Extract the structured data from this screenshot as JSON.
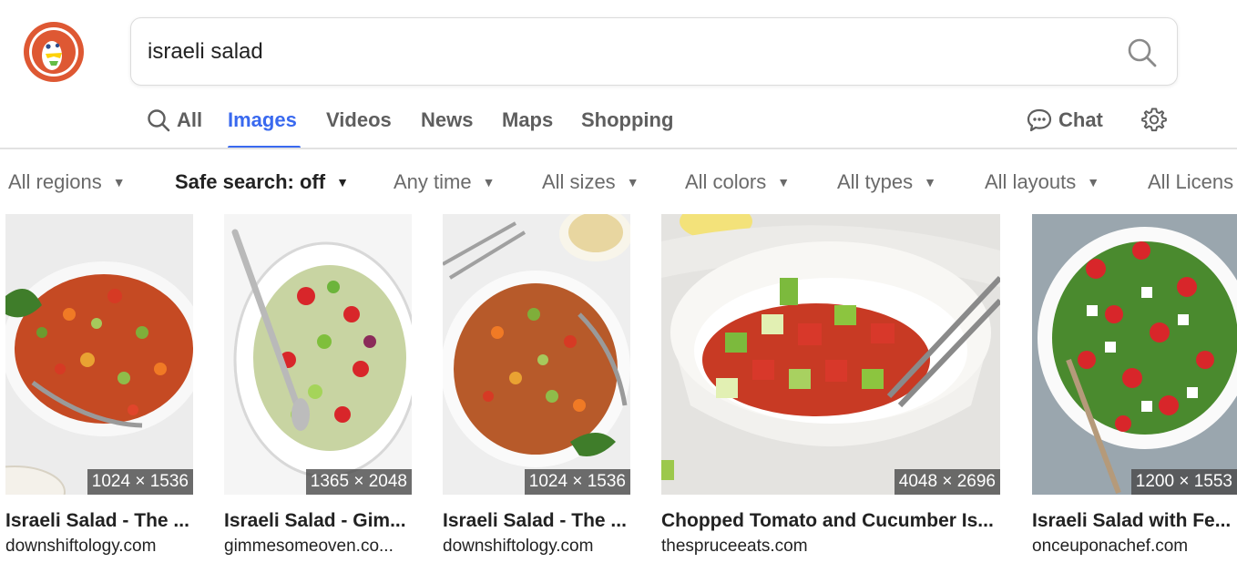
{
  "search": {
    "query": "israeli salad"
  },
  "tabs": [
    {
      "label": "All",
      "icon": "search-icon",
      "active": false
    },
    {
      "label": "Images",
      "active": true
    },
    {
      "label": "Videos",
      "active": false
    },
    {
      "label": "News",
      "active": false
    },
    {
      "label": "Maps",
      "active": false
    },
    {
      "label": "Shopping",
      "active": false
    }
  ],
  "chat": {
    "label": "Chat",
    "icon": "chat-icon"
  },
  "settings": {
    "icon": "gear-icon"
  },
  "filters": [
    {
      "label": "All regions"
    },
    {
      "label": "Safe search: off"
    },
    {
      "label": "Any time"
    },
    {
      "label": "All sizes"
    },
    {
      "label": "All colors"
    },
    {
      "label": "All types"
    },
    {
      "label": "All layouts"
    },
    {
      "label": "All Licens"
    }
  ],
  "results": [
    {
      "title": "Israeli Salad - The ...",
      "source": "downshiftology.com",
      "dims": "1024 × 1536"
    },
    {
      "title": "Israeli Salad - Gim...",
      "source": "gimmesomeoven.co...",
      "dims": "1365 × 2048"
    },
    {
      "title": "Israeli Salad - The ...",
      "source": "downshiftology.com",
      "dims": "1024 × 1536"
    },
    {
      "title": "Chopped Tomato and Cucumber Is...",
      "source": "thespruceeats.com",
      "dims": "4048 × 2696"
    },
    {
      "title": "Israeli Salad with Fe...",
      "source": "onceuponachef.com",
      "dims": "1200 × 1553"
    }
  ],
  "colors": {
    "accent": "#3969ef",
    "brand": "#de5833"
  }
}
